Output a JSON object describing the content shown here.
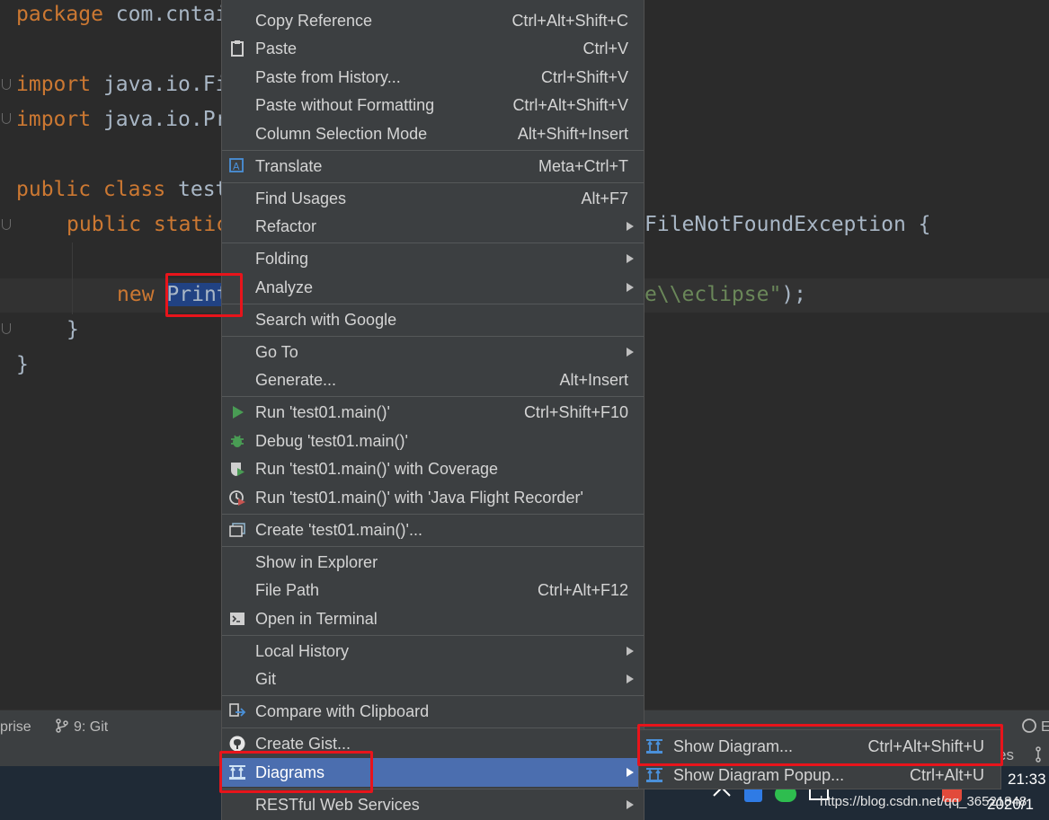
{
  "editor": {
    "line_package_kw": "package",
    "line_package_rest": " com.cntai",
    "line_import1_kw": "import",
    "line_import1_rest": " java.io.Fi",
    "line_import2_kw": "import",
    "line_import2_rest": " java.io.Pr",
    "line_class_kw": "public class",
    "line_class_rest": " test",
    "line_method_kw": "public static",
    "line_method_tail": "FileNotFoundException {",
    "line_new_kw": "new",
    "line_new_sel": "Print",
    "line_new_tail_str": "e\\\\eclipse\"",
    "line_new_tail_end": ");",
    "close_brace1": "}",
    "close_brace2": "}"
  },
  "context_menu": {
    "copy_reference": {
      "label": "Copy Reference",
      "shortcut": "Ctrl+Alt+Shift+C"
    },
    "paste": {
      "label": "Paste",
      "shortcut": "Ctrl+V",
      "icon": "clipboard-icon"
    },
    "paste_history": {
      "label": "Paste from History...",
      "shortcut": "Ctrl+Shift+V"
    },
    "paste_no_format": {
      "label": "Paste without Formatting",
      "shortcut": "Ctrl+Alt+Shift+V"
    },
    "column_selection": {
      "label": "Column Selection Mode",
      "shortcut": "Alt+Shift+Insert"
    },
    "translate": {
      "label": "Translate",
      "shortcut": "Meta+Ctrl+T",
      "icon": "translate-icon"
    },
    "find_usages": {
      "label": "Find Usages",
      "shortcut": "Alt+F7"
    },
    "refactor": {
      "label": "Refactor"
    },
    "folding": {
      "label": "Folding"
    },
    "analyze": {
      "label": "Analyze"
    },
    "search_google": {
      "label": "Search with Google"
    },
    "go_to": {
      "label": "Go To"
    },
    "generate": {
      "label": "Generate...",
      "shortcut": "Alt+Insert"
    },
    "run": {
      "label": "Run 'test01.main()'",
      "shortcut": "Ctrl+Shift+F10",
      "icon": "run-icon"
    },
    "debug": {
      "label": "Debug 'test01.main()'",
      "icon": "debug-icon"
    },
    "run_coverage": {
      "label": "Run 'test01.main()' with Coverage",
      "icon": "coverage-icon"
    },
    "run_jfr": {
      "label": "Run 'test01.main()' with 'Java Flight Recorder'",
      "icon": "flight-recorder-icon"
    },
    "create_config": {
      "label": "Create 'test01.main()'...",
      "icon": "run-config-icon"
    },
    "show_explorer": {
      "label": "Show in Explorer"
    },
    "file_path": {
      "label": "File Path",
      "shortcut": "Ctrl+Alt+F12"
    },
    "open_terminal": {
      "label": "Open in Terminal",
      "icon": "terminal-icon"
    },
    "local_history": {
      "label": "Local History"
    },
    "git": {
      "label": "Git"
    },
    "compare_clipboard": {
      "label": "Compare with Clipboard",
      "icon": "compare-icon"
    },
    "create_gist": {
      "label": "Create Gist...",
      "icon": "github-icon"
    },
    "diagrams": {
      "label": "Diagrams",
      "icon": "diagram-icon"
    },
    "restful": {
      "label": "RESTful Web Services"
    }
  },
  "submenu": {
    "show_diagram": {
      "label": "Show Diagram...",
      "shortcut": "Ctrl+Alt+Shift+U"
    },
    "show_diagram_popup": {
      "label": "Show Diagram Popup...",
      "shortcut": "Ctrl+Alt+U"
    }
  },
  "bottom": {
    "tool_left": "prise",
    "tool_git": "9: Git",
    "tool_right_partial": "E",
    "status_right": "es"
  },
  "taskbar": {
    "time": "21:33",
    "date": "2020/1",
    "watermark": "https://blog.csdn.net/qq_36521848"
  },
  "colors": {
    "highlight": "#4b6eaf",
    "annotation": "#e8141b",
    "keyword": "#cc7832",
    "string": "#6a8759"
  }
}
